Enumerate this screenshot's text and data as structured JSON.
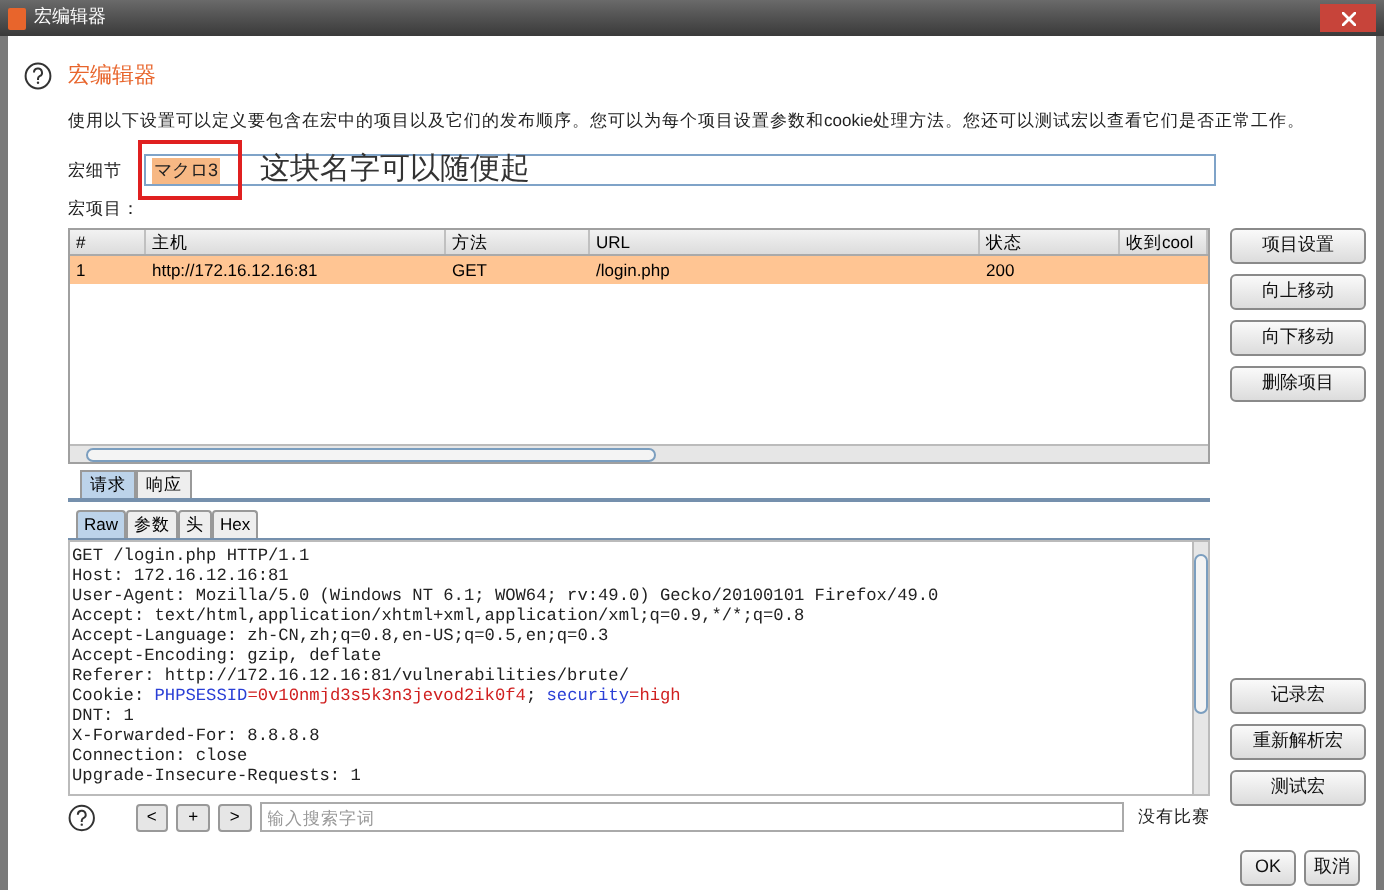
{
  "window": {
    "title": "宏编辑器"
  },
  "header": {
    "title": "宏编辑器",
    "description": "使用以下设置可以定义要包含在宏中的项目以及它们的发布顺序。您可以为每个项目设置参数和cookie处理方法。您还可以测试宏以查看它们是否正常工作。"
  },
  "macro_name": {
    "label": "宏细节",
    "value": "マクロ3"
  },
  "annotation": "这块名字可以随便起",
  "items_label": "宏项目：",
  "table": {
    "columns": [
      "#",
      "主机",
      "方法",
      "URL",
      "状态",
      "收到cool"
    ],
    "rows": [
      {
        "cells": [
          "1",
          "http://172.16.12.16:81",
          "GET",
          "/login.php",
          "200",
          ""
        ],
        "selected": true
      }
    ]
  },
  "side_buttons": [
    "项目设置",
    "向上移动",
    "向下移动",
    "删除项目"
  ],
  "tabs": [
    {
      "label": "请求",
      "selected": true
    },
    {
      "label": "响应",
      "selected": false
    }
  ],
  "subtabs": [
    {
      "label": "Raw",
      "selected": true
    },
    {
      "label": "参数",
      "selected": false
    },
    {
      "label": "头",
      "selected": false
    },
    {
      "label": "Hex",
      "selected": false
    }
  ],
  "request_lines": [
    [
      {
        "text": "GET /login.php HTTP/1.1",
        "kind": "plain"
      }
    ],
    [
      {
        "text": "Host: 172.16.12.16:81",
        "kind": "plain"
      }
    ],
    [
      {
        "text": "User-Agent: Mozilla/5.0 (Windows NT 6.1; WOW64; rv:49.0) Gecko/20100101 Firefox/49.0",
        "kind": "plain"
      }
    ],
    [
      {
        "text": "Accept: text/html,application/xhtml+xml,application/xml;q=0.9,*/*;q=0.8",
        "kind": "plain"
      }
    ],
    [
      {
        "text": "Accept-Language: zh-CN,zh;q=0.8,en-US;q=0.5,en;q=0.3",
        "kind": "plain"
      }
    ],
    [
      {
        "text": "Accept-Encoding: gzip, deflate",
        "kind": "plain"
      }
    ],
    [
      {
        "text": "Referer: http://172.16.12.16:81/vulnerabilities/brute/",
        "kind": "plain"
      }
    ],
    [
      {
        "text": "Cookie: ",
        "kind": "plain"
      },
      {
        "text": "PHPSESSID",
        "kind": "key"
      },
      {
        "text": "=0v10nmjd3s5k3n3jevod2ik0f4",
        "kind": "value"
      },
      {
        "text": "; ",
        "kind": "plain"
      },
      {
        "text": "security",
        "kind": "key"
      },
      {
        "text": "=high",
        "kind": "value"
      }
    ],
    [
      {
        "text": "DNT: 1",
        "kind": "plain"
      }
    ],
    [
      {
        "text": "X-Forwarded-For: 8.8.8.8",
        "kind": "plain"
      }
    ],
    [
      {
        "text": "Connection: close",
        "kind": "plain"
      }
    ],
    [
      {
        "text": "Upgrade-Insecure-Requests: 1",
        "kind": "plain"
      }
    ]
  ],
  "search": {
    "buttons": [
      "<",
      "+",
      ">"
    ],
    "placeholder": "输入搜索字词",
    "result": "没有比赛"
  },
  "macro_buttons": [
    "记录宏",
    "重新解析宏",
    "测试宏"
  ],
  "footer_buttons": [
    "OK",
    "取消"
  ]
}
